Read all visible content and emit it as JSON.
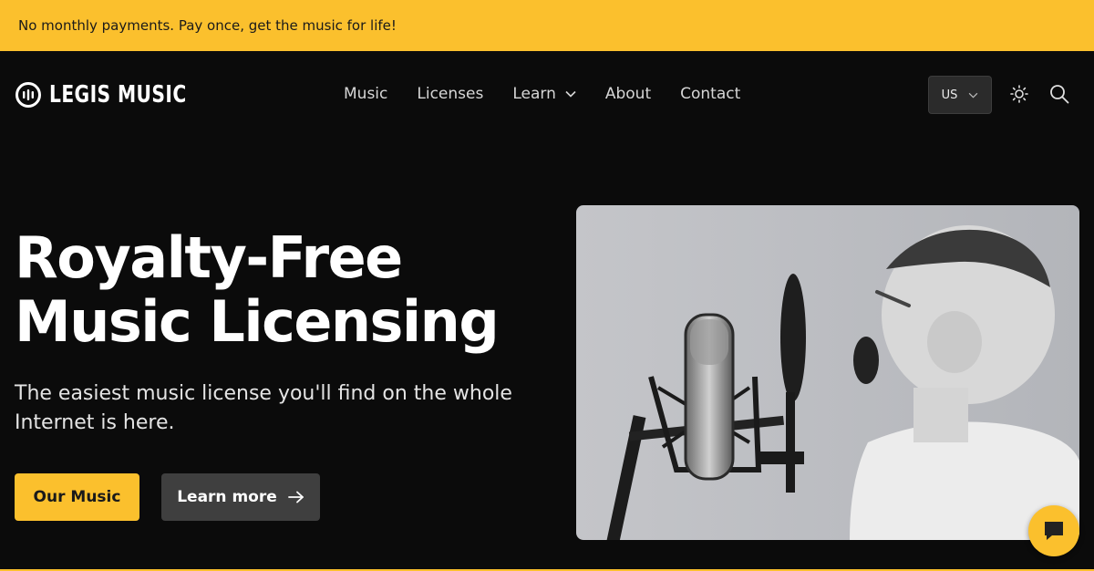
{
  "announcement": {
    "text": "No monthly payments. Pay once, get the music for life!"
  },
  "brand": {
    "name": "LEGIS MUSIC",
    "logo_icon": "legis-logo-icon"
  },
  "nav": {
    "items": [
      {
        "label": "Music"
      },
      {
        "label": "Licenses"
      },
      {
        "label": "Learn",
        "has_dropdown": true
      },
      {
        "label": "About"
      },
      {
        "label": "Contact"
      }
    ]
  },
  "locale": {
    "value": "US",
    "icon": "chevron-down-icon"
  },
  "header_icons": {
    "theme": "sun-icon",
    "search": "search-icon"
  },
  "hero": {
    "title_line1": "Royalty-Free",
    "title_line2": "Music Licensing",
    "subtitle": "The easiest music license you'll find on the whole Internet is here.",
    "primary_cta": "Our Music",
    "secondary_cta": "Learn more",
    "image_alt": "Child singing into a studio microphone"
  },
  "chat": {
    "icon": "chat-bubble-icon"
  },
  "colors": {
    "accent": "#fbc02d",
    "background": "#0b0b0b",
    "secondary_button": "#3f3f3f"
  }
}
